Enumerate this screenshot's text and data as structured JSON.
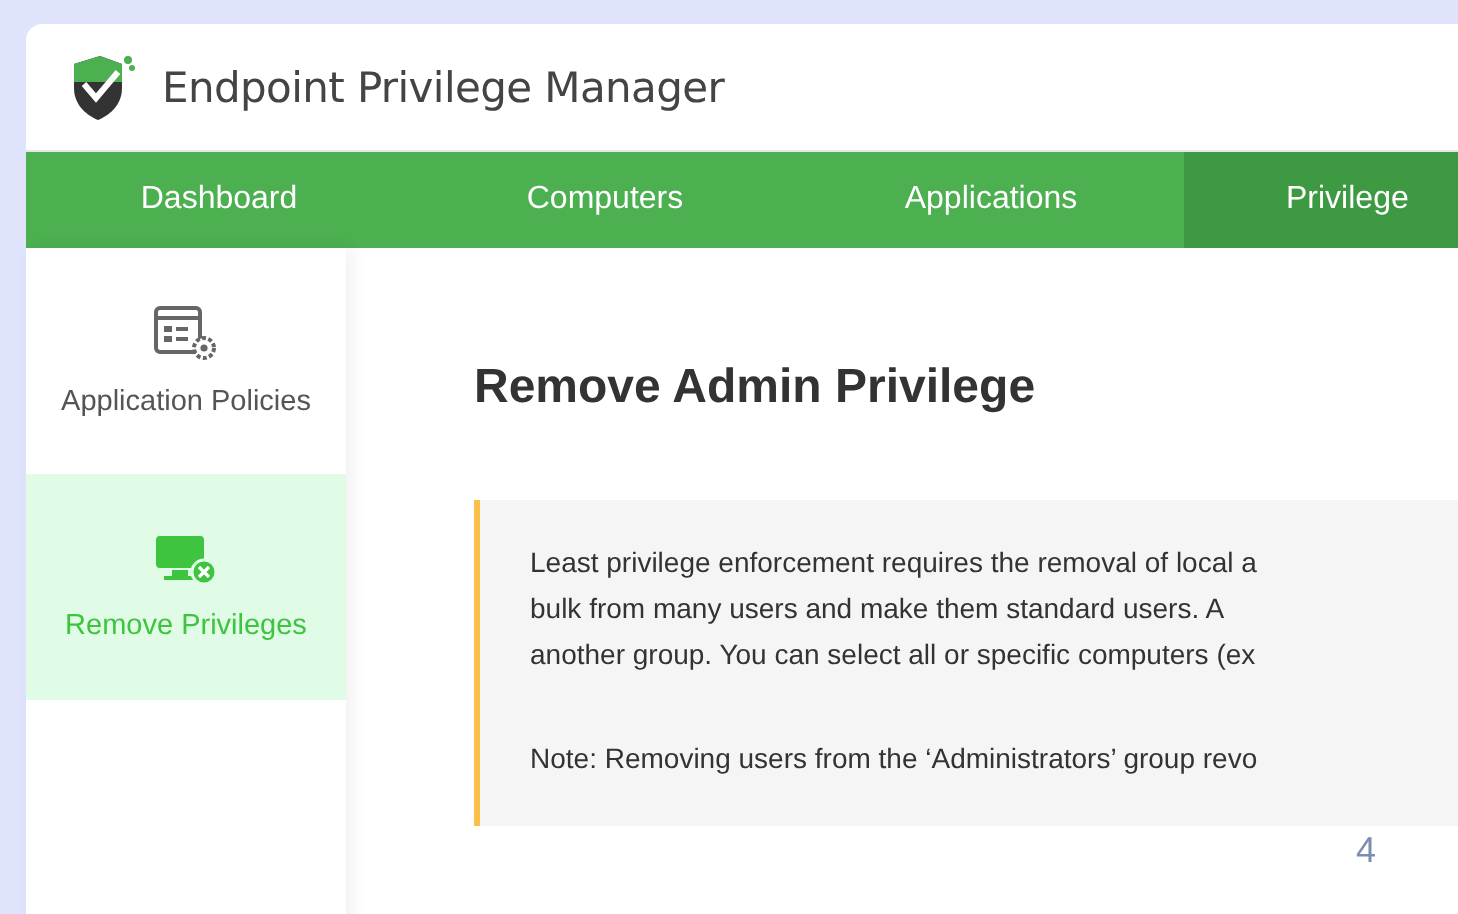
{
  "app": {
    "title": "Endpoint Privilege Manager"
  },
  "nav": [
    {
      "label": "Dashboard",
      "selected": false
    },
    {
      "label": "Computers",
      "selected": false
    },
    {
      "label": "Applications",
      "selected": false
    },
    {
      "label": "Privilege",
      "selected": true
    }
  ],
  "sidebar": {
    "items": [
      {
        "label": "Application Policies",
        "kind": "policies",
        "selected": false
      },
      {
        "label": "Remove Privileges",
        "kind": "remove",
        "selected": true
      }
    ]
  },
  "page": {
    "heading": "Remove Admin Privilege",
    "info_lines": [
      "Least privilege enforcement requires the removal of local a",
      "bulk from many users and make them standard users. A",
      "another group. You can select all or specific computers (ex"
    ],
    "note": "Note: Removing users from the ‘Administrators’ group revo"
  },
  "page_number": "4"
}
